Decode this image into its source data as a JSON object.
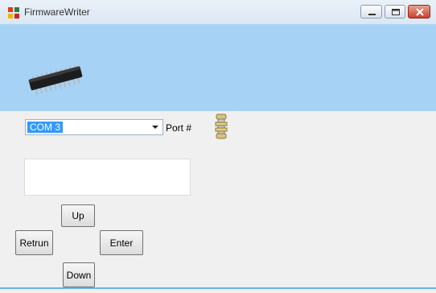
{
  "window": {
    "title": "FirmwareWriter"
  },
  "icons": {
    "app": "app-icon",
    "chip": "microchip-icon",
    "connector": "serial-connector-icon"
  },
  "colors": {
    "banner": "#a6d2f5",
    "selection": "#3399ff",
    "close": "#c7432c"
  },
  "port": {
    "selected": "COM 3",
    "label": "Port #"
  },
  "display": {
    "text": ""
  },
  "buttons": {
    "up": "Up",
    "return": "Retrun",
    "enter": "Enter",
    "down": "Down"
  }
}
